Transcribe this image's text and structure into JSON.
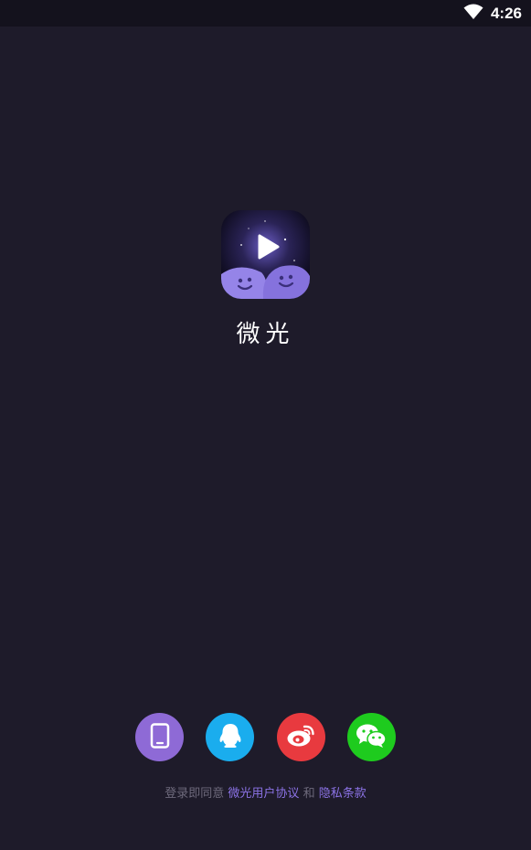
{
  "status_bar": {
    "time": "4:26",
    "icons": [
      "wifi-icon"
    ]
  },
  "app": {
    "name": "微光",
    "logo_icon": "app-logo-icon"
  },
  "login": {
    "methods": [
      {
        "name": "phone",
        "icon": "phone-icon",
        "color": "#8e6ad6"
      },
      {
        "name": "qq",
        "icon": "qq-icon",
        "color": "#1aadee"
      },
      {
        "name": "weibo",
        "icon": "weibo-icon",
        "color": "#e83a3f"
      },
      {
        "name": "wechat",
        "icon": "wechat-icon",
        "color": "#1ecb1e"
      }
    ]
  },
  "agreement": {
    "prefix": "登录即同意 ",
    "user_agreement": "微光用户协议",
    "and": " 和 ",
    "privacy_policy": "隐私条款"
  },
  "colors": {
    "background": "#1e1b2a",
    "status_bar": "#14121d",
    "accent": "#8c73e6",
    "muted_text": "#6e6a7c"
  }
}
